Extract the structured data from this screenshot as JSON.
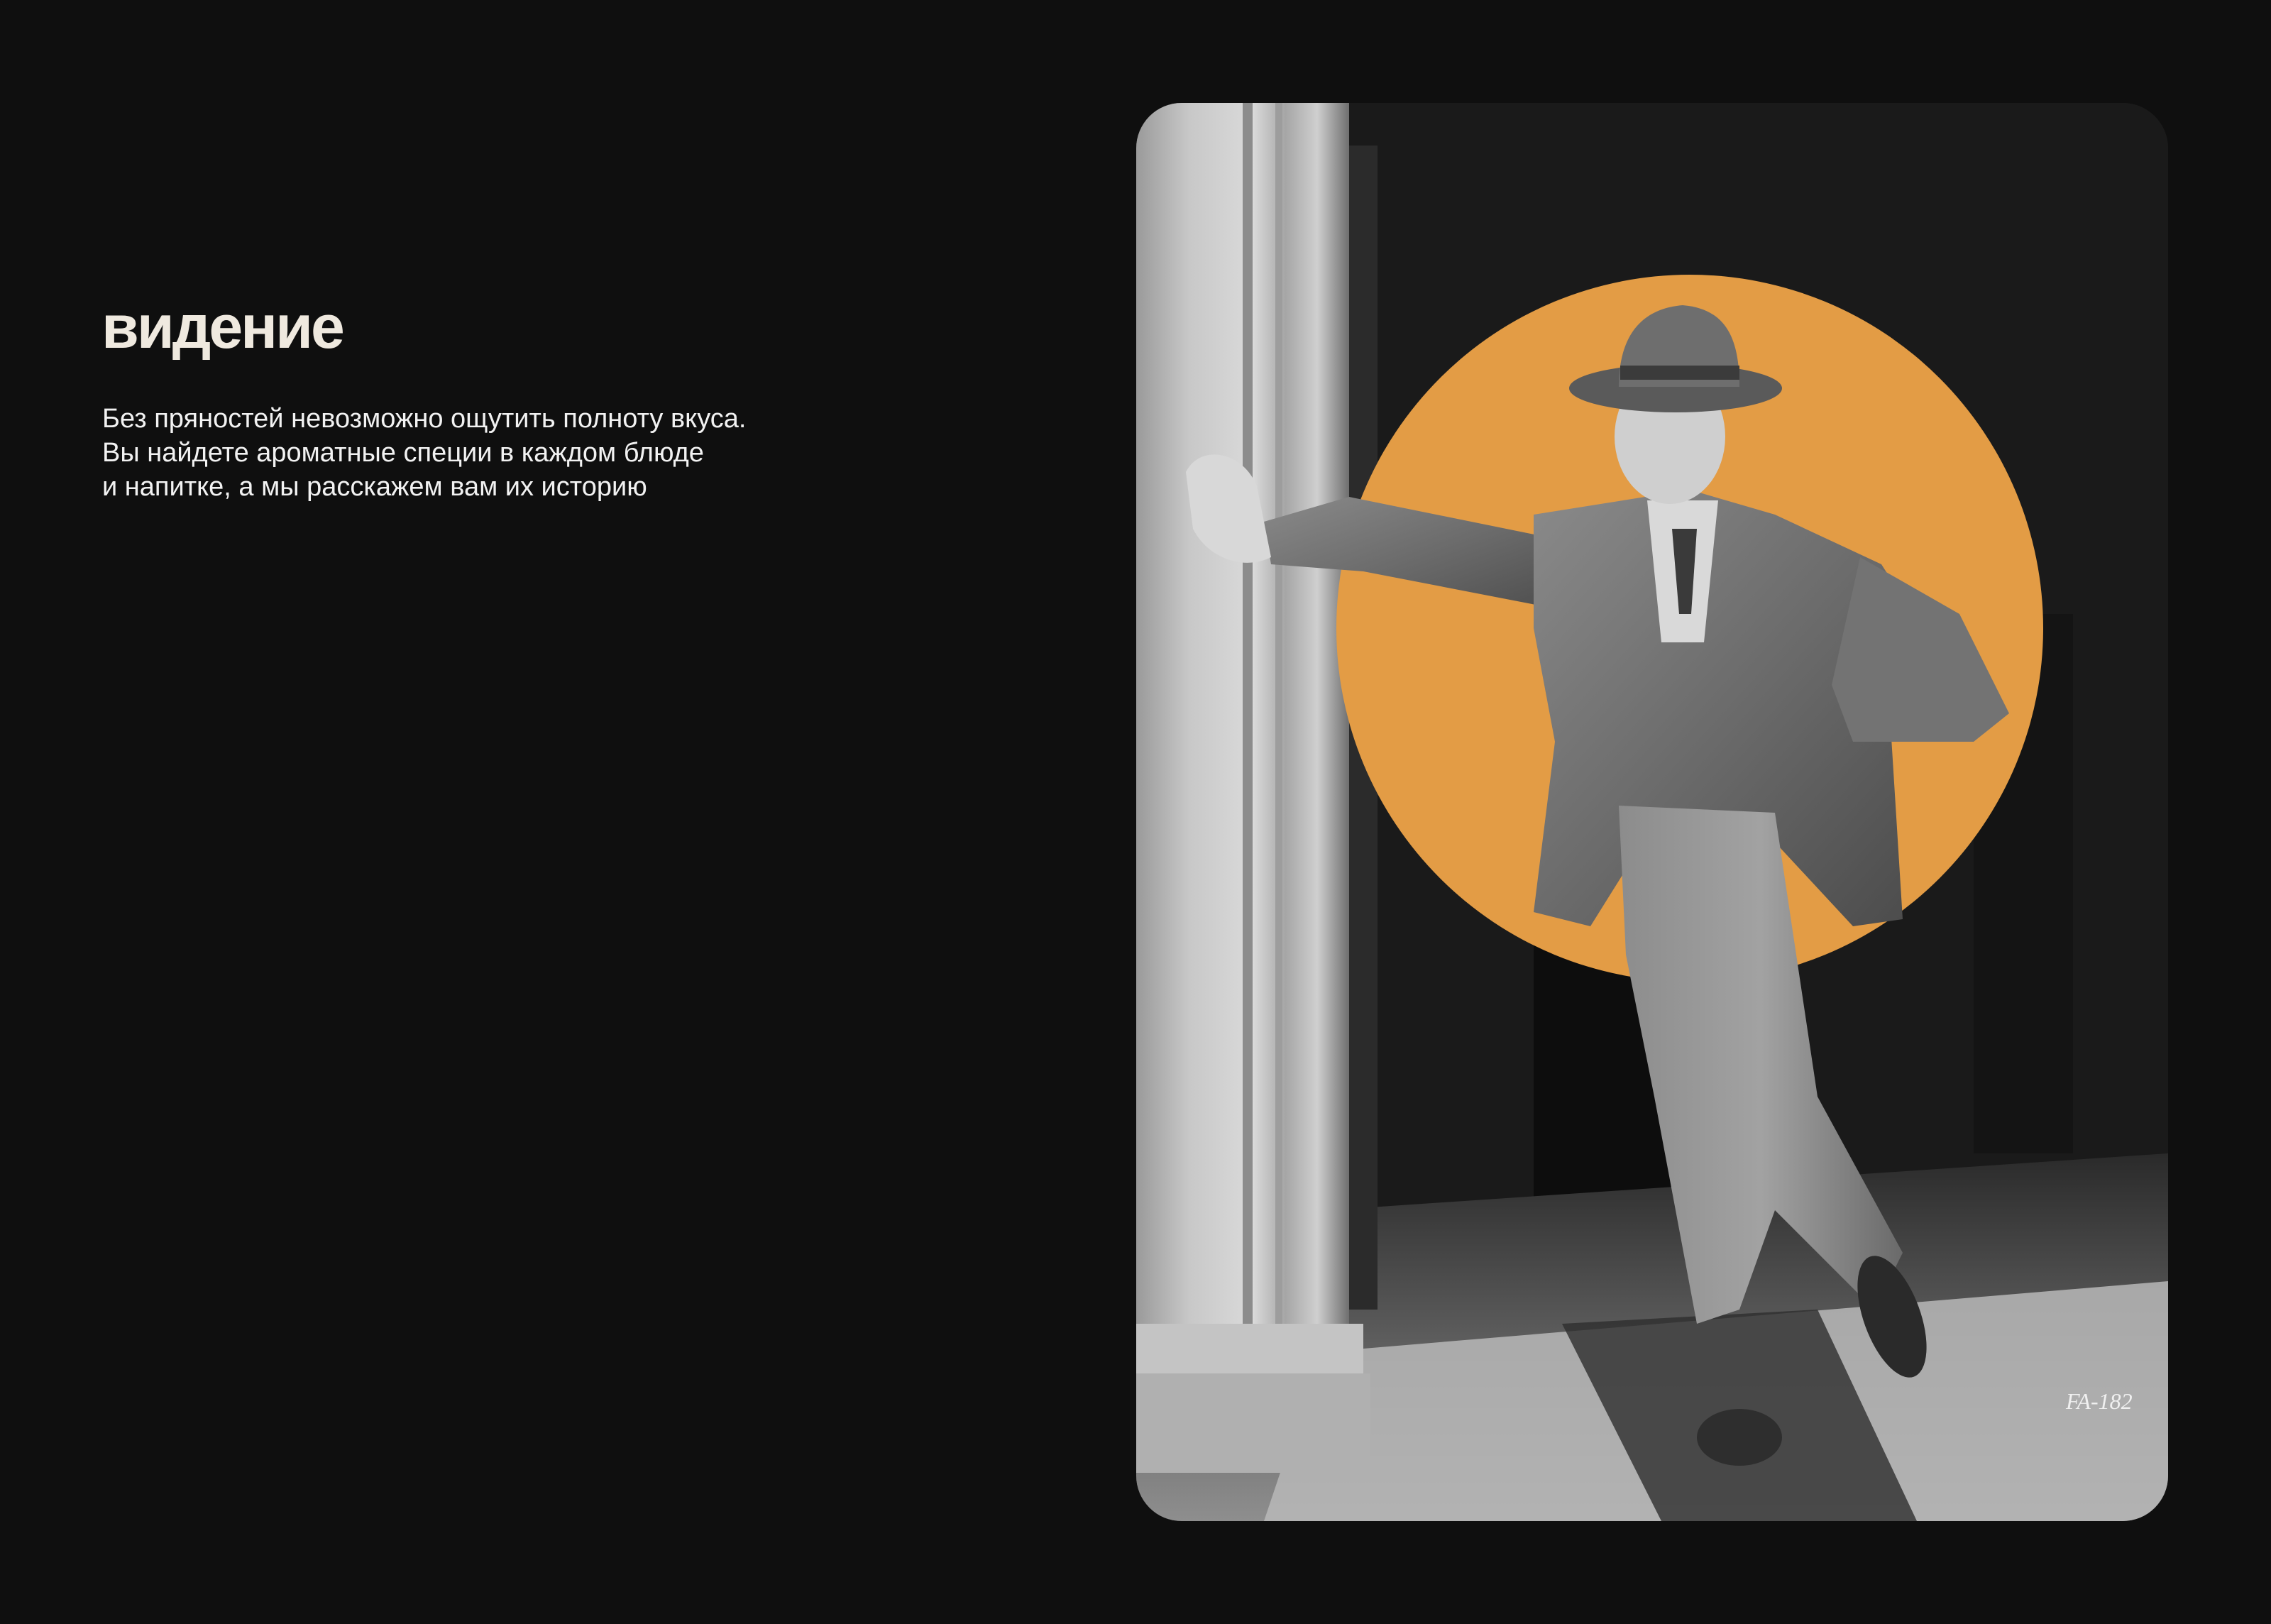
{
  "title": "видение",
  "description_lines": [
    "Без пряностей невозможно ощутить полноту вкуса.",
    "Вы найдете ароматные специи в каждом блюде",
    "и напитке, а мы расскажем вам их историю"
  ],
  "photo": {
    "caption": "FA-182",
    "accent_color": "#e39c45"
  }
}
